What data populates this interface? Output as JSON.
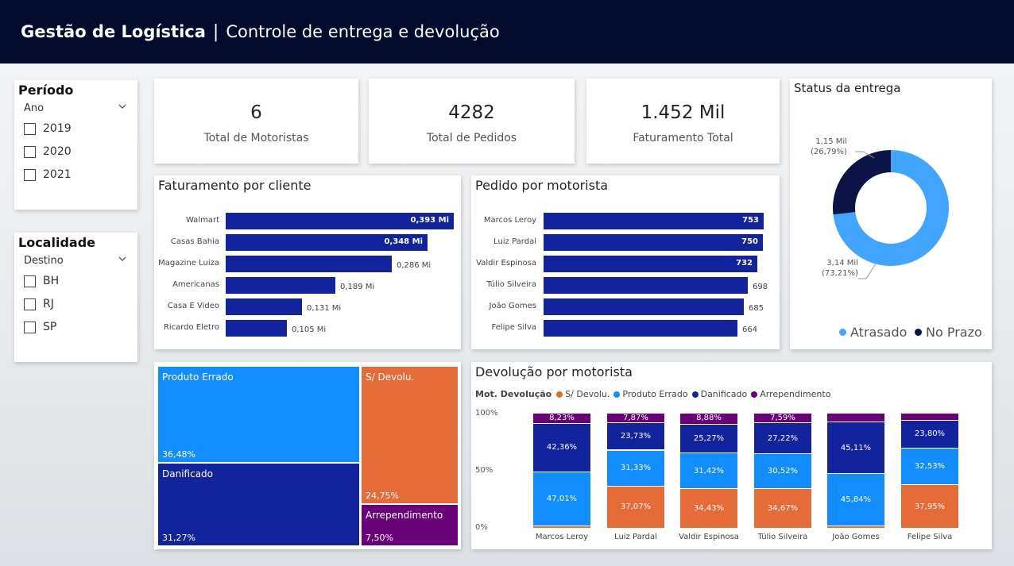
{
  "header": {
    "title": "Gestão de Logística",
    "separator": "|",
    "subtitle": "Controle de entrega e devolução"
  },
  "periodo": {
    "title": "Período",
    "field": "Ano",
    "options": [
      "2019",
      "2020",
      "2021"
    ]
  },
  "localidade": {
    "title": "Localidade",
    "field": "Destino",
    "options": [
      "BH",
      "RJ",
      "SP"
    ]
  },
  "kpis": [
    {
      "value": "6",
      "label": "Total de Motoristas"
    },
    {
      "value": "4282",
      "label": "Total de Pedidos"
    },
    {
      "value": "1.452 Mil",
      "label": "Faturamento Total"
    }
  ],
  "colors": {
    "navy": "#12239e",
    "blue": "#118dff",
    "orange": "#e66c37",
    "purple": "#6b007b",
    "dark_navy": "#0b1347",
    "light_blue": "#41a4ff",
    "header_bg": "#020a2e"
  },
  "charts": {
    "faturamento_cliente": {
      "title": "Faturamento por cliente",
      "chart_data": {
        "type": "bar",
        "orientation": "horizontal",
        "categories": [
          "Walmart",
          "Casas Bahia",
          "Magazine Luiza",
          "Americanas",
          "Casa E Video",
          "Ricardo Eletro"
        ],
        "values": [
          0.393,
          0.348,
          0.286,
          0.189,
          0.131,
          0.105
        ],
        "value_labels": [
          "0,393 Mi",
          "0,348 Mi",
          "0,286 Mi",
          "0,189 Mi",
          "0,131 Mi",
          "0,105 Mi"
        ],
        "xlim": [
          0,
          0.393
        ]
      }
    },
    "pedido_motorista": {
      "title": "Pedido por motorista",
      "chart_data": {
        "type": "bar",
        "orientation": "horizontal",
        "categories": [
          "Marcos Leroy",
          "Luiz Pardal",
          "Valdir Espinosa",
          "Túlio Silveira",
          "João Gomes",
          "Felipe Silva"
        ],
        "values": [
          753,
          750,
          732,
          698,
          685,
          664
        ],
        "value_labels": [
          "753",
          "750",
          "732",
          "698",
          "685",
          "664"
        ],
        "xlim": [
          0,
          753
        ]
      }
    },
    "status_entrega": {
      "title": "Status da entrega",
      "chart_data": {
        "type": "pie",
        "hole": true,
        "categories": [
          "Atrasado",
          "No Prazo"
        ],
        "values": [
          3.14,
          1.15
        ],
        "value_labels": [
          "3,14 Mil",
          "1,15 Mil"
        ],
        "percent_labels": [
          "(73,21%)",
          "(26,79%)"
        ],
        "legend": [
          "Atrasado",
          "No Prazo"
        ]
      }
    },
    "treemap": {
      "chart_data": {
        "type": "treemap",
        "categories": [
          "Produto Errado",
          "Danificado",
          "S/ Devolu.",
          "Arrependimento"
        ],
        "values": [
          36.48,
          31.27,
          24.75,
          7.5
        ],
        "value_labels": [
          "36,48%",
          "31,27%",
          "24,75%",
          "7,50%"
        ]
      }
    },
    "devolucao_motorista": {
      "title": "Devolução por motorista",
      "legend_title": "Mot. Devolução",
      "chart_data": {
        "type": "bar",
        "stacked": "percent",
        "categories": [
          "Marcos Leroy",
          "Luiz Pardal",
          "Valdir Espinosa",
          "Túlio Silveira",
          "João Gomes",
          "Felipe Silva"
        ],
        "yticks": [
          "100%",
          "50%",
          "0%"
        ],
        "ylim": [
          0,
          100
        ],
        "series": [
          {
            "name": "S/ Devolu.",
            "values": [
              2.4,
              37.07,
              34.43,
              34.67,
              2.05,
              37.95
            ],
            "labels": [
              "",
              "37,07%",
              "34,43%",
              "34,67%",
              "",
              "37,95%"
            ]
          },
          {
            "name": "Produto Errado",
            "values": [
              47.01,
              31.33,
              31.42,
              30.52,
              45.84,
              32.53
            ],
            "labels": [
              "47,01%",
              "31,33%",
              "31,42%",
              "30,52%",
              "45,84%",
              "32,53%"
            ]
          },
          {
            "name": "Danificado",
            "values": [
              42.36,
              23.73,
              25.27,
              27.22,
              45.11,
              23.8
            ],
            "labels": [
              "42,36%",
              "23,73%",
              "25,27%",
              "27,22%",
              "45,11%",
              "23,80%"
            ]
          },
          {
            "name": "Arrependimento",
            "values": [
              8.23,
              7.87,
              8.88,
              7.59,
              7.0,
              5.72
            ],
            "labels": [
              "8,23%",
              "7,87%",
              "8,88%",
              "7,59%",
              "",
              ""
            ]
          }
        ]
      }
    }
  }
}
